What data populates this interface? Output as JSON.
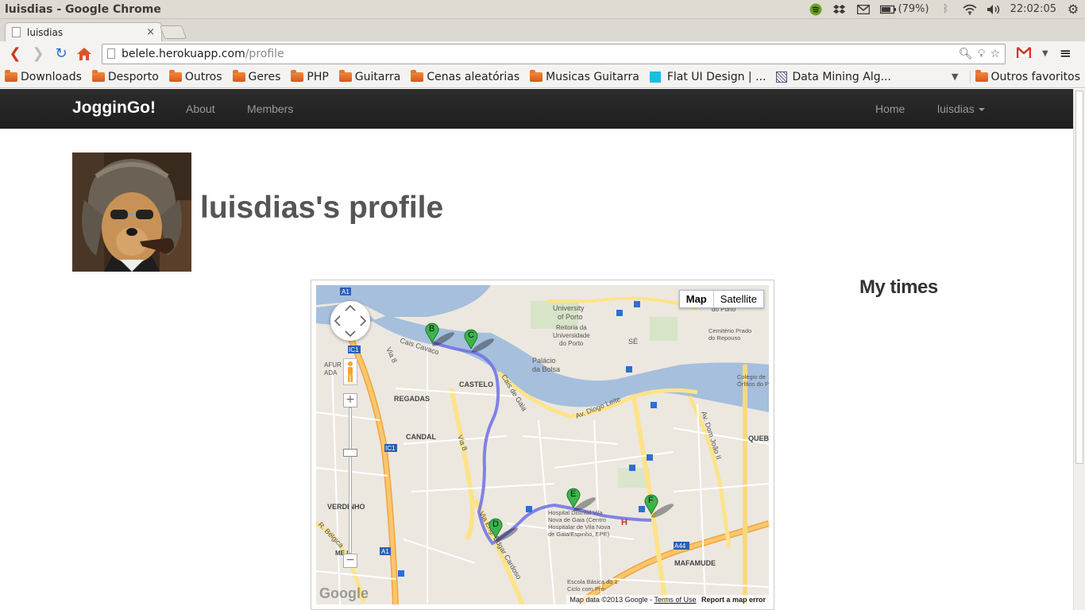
{
  "os": {
    "window_title": "luisdias - Google Chrome",
    "battery": "(79%)",
    "clock": "22:02:05"
  },
  "browser": {
    "tab_title": "luisdias",
    "url_host": "belele.herokuapp.com",
    "url_path": "/profile",
    "bookmarks": [
      "Downloads",
      "Desporto",
      "Outros",
      "Geres",
      "PHP",
      "Guitarra",
      "Cenas aleatórias",
      "Musicas Guitarra",
      "Flat UI Design | ...",
      "Data Mining Alg..."
    ],
    "other_bookmarks": "Outros favoritos"
  },
  "navbar": {
    "brand": "JogginGo!",
    "about": "About",
    "members": "Members",
    "home": "Home",
    "user": "luisdias"
  },
  "profile": {
    "title": "luisdias's profile",
    "times_heading": "My times"
  },
  "map": {
    "type_map": "Map",
    "type_satellite": "Satellite",
    "attribution": "Map data ©2013 Google",
    "terms": "Terms of Use",
    "report": "Report a map error",
    "logo": "Google",
    "markers": [
      "B",
      "C",
      "D",
      "E",
      "F"
    ],
    "labels": {
      "university": "University of Porto",
      "reitoria": "Reitoria da Universidade do Porto",
      "se": "SÉ",
      "palacio": "Palácio da Bolsa",
      "cais_gaia": "Cais de Gaia",
      "diogo_leite": "Av. Diogo Leite",
      "castelo": "CASTELO",
      "regadas": "REGADAS",
      "candal": "CANDAL",
      "verdinho": "VERDINHO",
      "via8": "Via 8",
      "cais_cavaco": "Cais Cavaco",
      "afurada": "AFUR ADA",
      "hospital": "Hospital Distrital Vila Nova de Gaia (Centro Hospitalar de Vila Nova de Gaia/Espinho, EPE)",
      "mafamude": "MAFAMUDE",
      "dom_joao": "Av. Dom João II",
      "queb": "QUEB",
      "edgar": "Via Eng. Edgar Cardoso",
      "belgica": "R. Bélgica",
      "escola": "Escola Básica do 1 Ciclo com Pré-",
      "cemiterio": "Cemitério Prado do Repouso",
      "colegio": "Colégio de Órfãos do P",
      "porto": "do Porto",
      "a1": "A1",
      "ic1": "IC1",
      "a44": "A44",
      "mirim": "ME L"
    }
  }
}
